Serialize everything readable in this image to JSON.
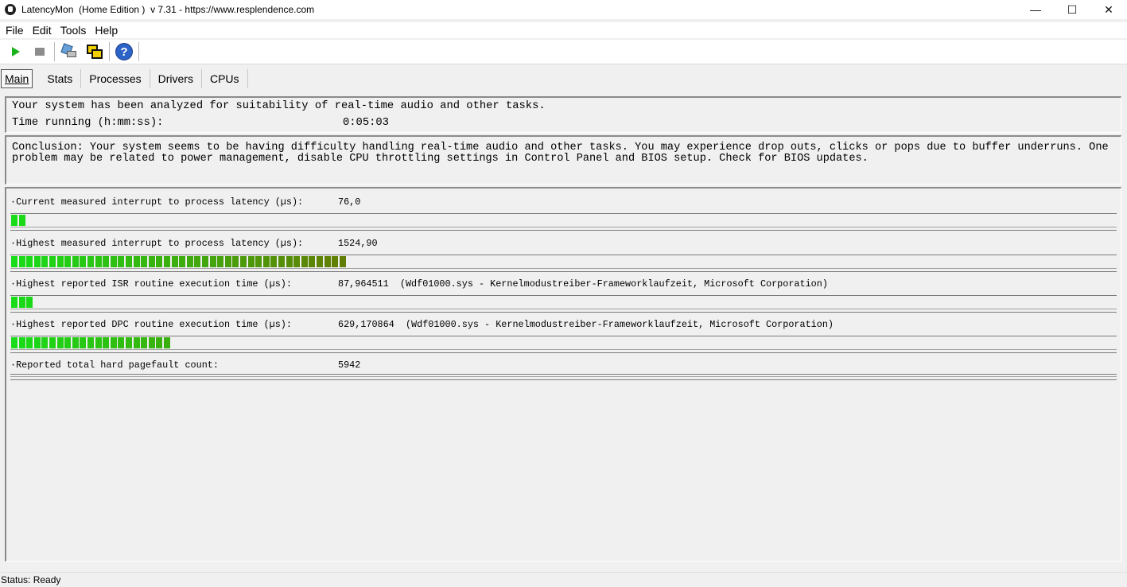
{
  "window": {
    "title": "LatencyMon  (Home Edition )  v 7.31 - https://www.resplendence.com",
    "minimize_glyph": "—",
    "maximize_glyph": "☐",
    "close_glyph": "✕"
  },
  "menu": [
    "File",
    "Edit",
    "Tools",
    "Help"
  ],
  "toolbar": {
    "icons": [
      "play-icon",
      "stop-icon",
      "tool-icon",
      "window-icon",
      "help-icon"
    ],
    "help_glyph": "?"
  },
  "tabs": [
    "Main",
    "Stats",
    "Processes",
    "Drivers",
    "CPUs"
  ],
  "active_tab": "Main",
  "summary": {
    "line1": "Your system has been analyzed for suitability of real-time audio and other tasks.",
    "time_label": "Time running (h:mm:ss):",
    "time_value": "0:05:03"
  },
  "conclusion": "Conclusion: Your system seems to be having difficulty handling real-time audio and other tasks. You may experience drop outs, clicks or pops due to buffer underruns. One problem may be related to power management, disable CPU throttling settings in Control Panel and BIOS setup. Check for BIOS updates.",
  "metrics": [
    {
      "label": "·Current measured interrupt to process latency (µs):",
      "value": "76,0",
      "bar_segments": 2
    },
    {
      "label": "·Highest measured interrupt to process latency (µs):",
      "value": "1524,90",
      "bar_segments": 44
    },
    {
      "label": "·Highest reported ISR routine execution time (µs):",
      "value": "87,964511  (Wdf01000.sys - Kernelmodustreiber-Frameworklaufzeit, Microsoft Corporation)",
      "bar_segments": 3
    },
    {
      "label": "·Highest reported DPC routine execution time (µs):",
      "value": "629,170864  (Wdf01000.sys - Kernelmodustreiber-Frameworklaufzeit, Microsoft Corporation)",
      "bar_segments": 21
    },
    {
      "label": "·Reported total hard pagefault count:",
      "value": "5942",
      "bar_segments": 0
    }
  ],
  "colors": {
    "bar_green": "#18dc18",
    "bar_olive": "#6e6e00"
  },
  "status": "Status: Ready"
}
